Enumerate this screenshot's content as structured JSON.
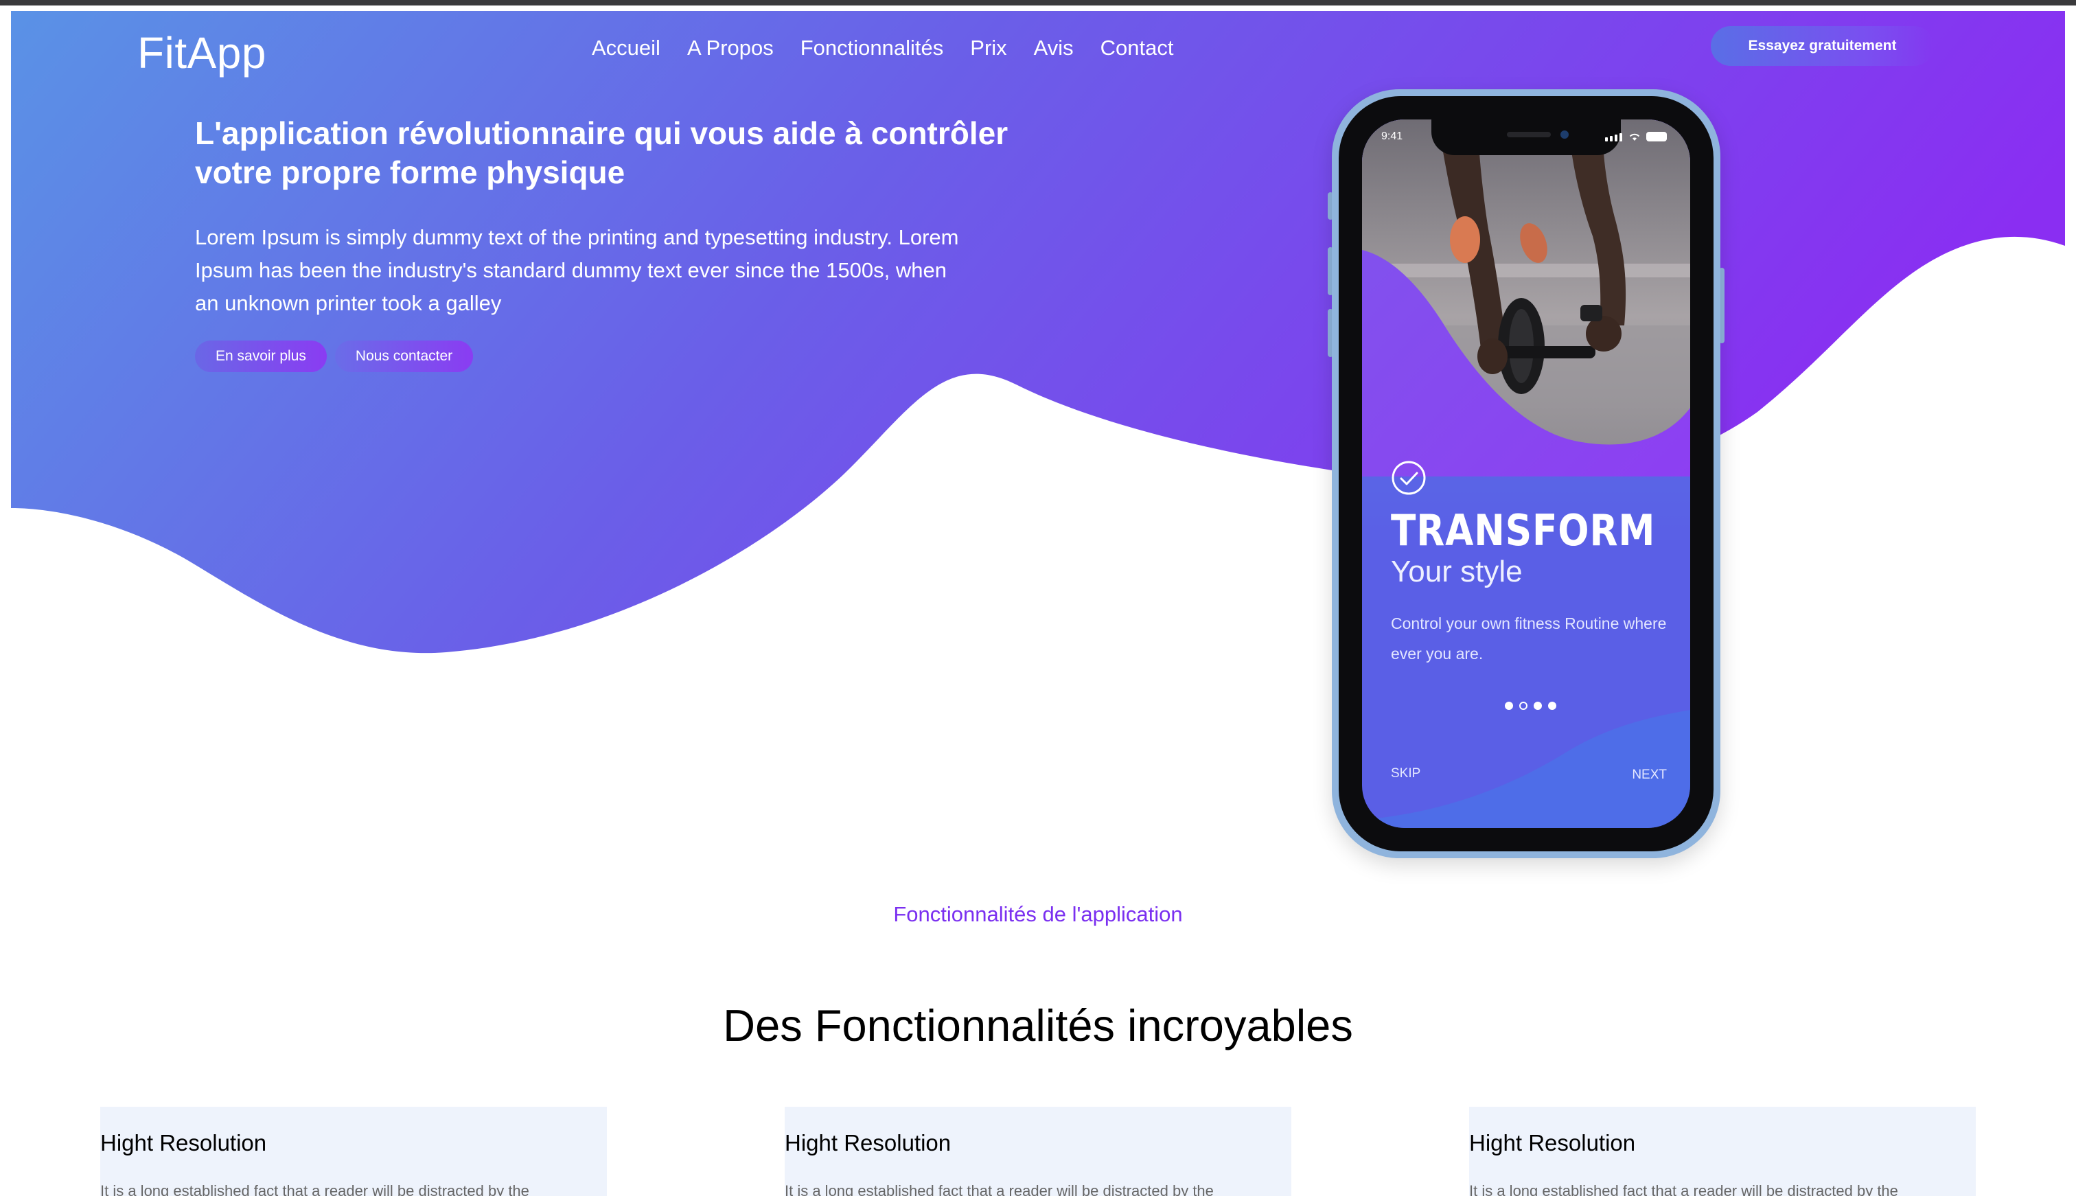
{
  "brand": {
    "logo": "FitApp"
  },
  "nav": {
    "items": [
      "Accueil",
      "A Propos",
      "Fonctionnalités",
      "Prix",
      "Avis",
      "Contact"
    ],
    "cta": "Essayez gratuitement"
  },
  "hero": {
    "title": "L'application révolutionnaire qui vous aide à contrôler votre propre forme physique",
    "text": "Lorem Ipsum is simply dummy text of the printing and typesetting industry. Lorem Ipsum has been the industry's standard dummy text ever since the 1500s, when an unknown printer took a galley",
    "buttons": {
      "learn_more": "En savoir plus",
      "contact": "Nous contacter"
    }
  },
  "phone_screen": {
    "time": "9:41",
    "headline": "TRANSFORM",
    "subheadline": "Your style",
    "description": "Control your own fitness Routine where ever you are.",
    "skip": "SKIP",
    "next": "NEXT",
    "pager": {
      "total": 4,
      "current": 2
    }
  },
  "features": {
    "label": "Fonctionnalités de l'application",
    "title": "Des Fonctionnalités incroyables",
    "cards": [
      {
        "title": "Hight Resolution",
        "text": "It is a long established fact that a reader will be distracted by the"
      },
      {
        "title": "Hight Resolution",
        "text": "It is a long established fact that a reader will be distracted by the"
      },
      {
        "title": "Hight Resolution",
        "text": "It is a long established fact that a reader will be distracted by the"
      }
    ]
  },
  "colors": {
    "gradient_start": "#5a8ee6",
    "gradient_mid": "#6b63e8",
    "gradient_end": "#8a2ef2",
    "accent_purple": "#7a2ff0",
    "card_bg": "#eef3fc"
  },
  "icons": [
    "check-circle-icon",
    "signal-icon",
    "wifi-icon",
    "battery-icon"
  ]
}
